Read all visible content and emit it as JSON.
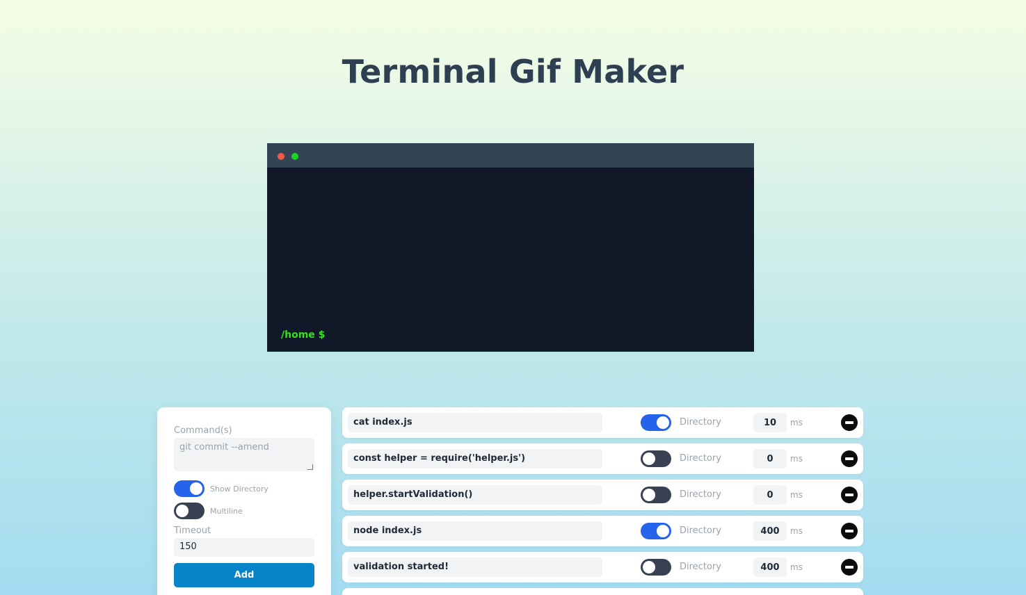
{
  "page": {
    "title": "Terminal Gif Maker"
  },
  "terminal": {
    "prompt": "/home $",
    "colors": {
      "background": "#111827",
      "bar": "#334555",
      "prompt": "#35e31c",
      "dot_red": "#f55a46",
      "dot_green": "#1bd320"
    }
  },
  "form": {
    "command_label": "Command(s)",
    "command_placeholder": "git commit --amend",
    "show_directory_label": "Show Directory",
    "show_directory_on": true,
    "multiline_label": "Multiline",
    "multiline_on": false,
    "timeout_label": "Timeout",
    "timeout_value": "150",
    "add_label": "Add"
  },
  "commands": [
    {
      "command": "cat index.js",
      "show_directory": true,
      "directory_label": "Directory",
      "delay": "10",
      "unit": "ms"
    },
    {
      "command": "const helper = require('helper.js')",
      "show_directory": false,
      "directory_label": "Directory",
      "delay": "0",
      "unit": "ms"
    },
    {
      "command": "helper.startValidation()",
      "show_directory": false,
      "directory_label": "Directory",
      "delay": "0",
      "unit": "ms"
    },
    {
      "command": "node index.js",
      "show_directory": true,
      "directory_label": "Directory",
      "delay": "400",
      "unit": "ms"
    },
    {
      "command": "validation started!",
      "show_directory": false,
      "directory_label": "Directory",
      "delay": "400",
      "unit": "ms"
    }
  ],
  "colors": {
    "toggle_on": "#2563eb",
    "toggle_off": "#374151",
    "add_button": "#0784c8",
    "title": "#2f3f52"
  }
}
